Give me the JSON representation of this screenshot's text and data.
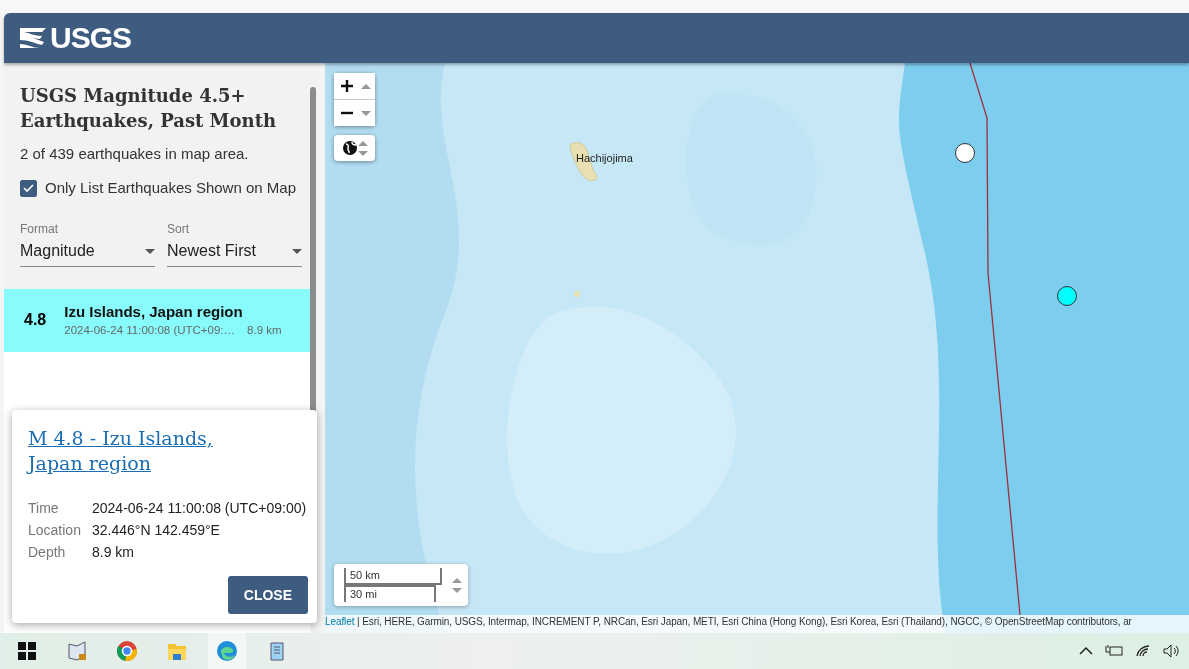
{
  "header": {
    "logo": "USGS"
  },
  "sidebar": {
    "title": "USGS Magnitude 4.5+ Earthquakes, Past Month",
    "count": "2 of 439 earthquakes in map area.",
    "filter": {
      "label": "Only List Earthquakes Shown on Map",
      "checked": true
    },
    "selects": [
      {
        "label": "Format",
        "value": "Magnitude"
      },
      {
        "label": "Sort",
        "value": "Newest First"
      }
    ],
    "earthquakes": [
      {
        "magnitude": "4.8",
        "place": "Izu Islands, Japan region",
        "time": "2024-06-24 11:00:08 (UTC+09:…",
        "depth": "8.9 km",
        "selected": true
      }
    ]
  },
  "map": {
    "place_label": "Hachijojima",
    "markers": [
      {
        "color": "#ffffff"
      },
      {
        "color": "#00ffff"
      }
    ],
    "scale": [
      "50 km",
      "30 mi"
    ],
    "attribution": {
      "link": "Leaflet",
      "text": "| Esri, HERE, Garmin, USGS, Intermap, INCREMENT P, NRCan, Esri Japan, METI, Esri China (Hong Kong), Esri Korea, Esri (Thailand), NGCC, © OpenStreetMap contributors, ar"
    }
  },
  "popup": {
    "title": "M 4.8 - Izu Islands, Japan region",
    "rows": [
      {
        "label": "Time",
        "value": "2024-06-24 11:00:08 (UTC+09:00)"
      },
      {
        "label": "Location",
        "value": "32.446°N 142.459°E"
      },
      {
        "label": "Depth",
        "value": "8.9 km"
      }
    ],
    "button": "CLOSE"
  },
  "taskbar": {
    "apps": [
      {
        "kind": "start",
        "selected": false
      },
      {
        "kind": "reader",
        "selected": false
      },
      {
        "kind": "chrome",
        "selected": false
      },
      {
        "kind": "folder",
        "selected": false
      },
      {
        "kind": "edge",
        "selected": true
      },
      {
        "kind": "notepad",
        "selected": false
      }
    ]
  }
}
